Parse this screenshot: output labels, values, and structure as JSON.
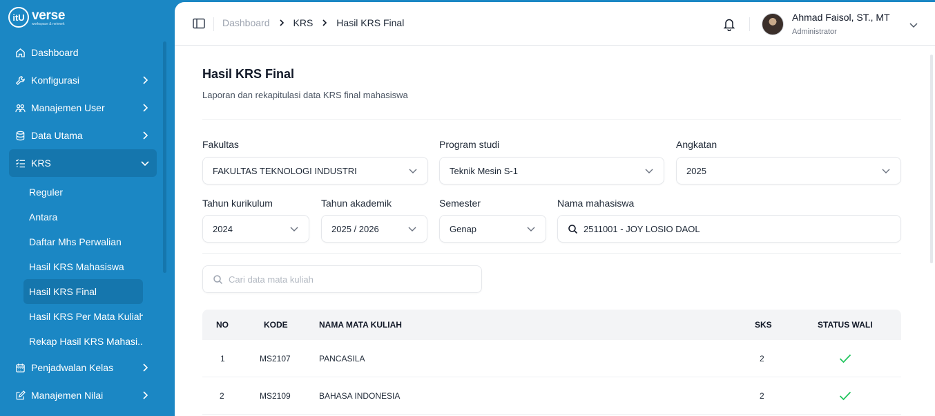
{
  "brand": {
    "mark": "itU",
    "word": "verse",
    "sub": "workspace & network"
  },
  "sidebar": {
    "items": [
      {
        "label": "Dashboard",
        "icon": "home-icon",
        "has_chevron": false
      },
      {
        "label": "Konfigurasi",
        "icon": "wrench-icon",
        "has_chevron": true
      },
      {
        "label": "Manajemen User",
        "icon": "users-icon",
        "has_chevron": true
      },
      {
        "label": "Data Utama",
        "icon": "database-icon",
        "has_chevron": true
      },
      {
        "label": "KRS",
        "icon": "list-check-icon",
        "has_chevron": true,
        "expanded": true
      }
    ],
    "krs_sub": [
      "Reguler",
      "Antara",
      "Daftar Mhs Perwalian",
      "Hasil KRS Mahasiswa",
      "Hasil KRS Final",
      "Hasil KRS Per Mata Kuliah",
      "Rekap Hasil KRS Mahasi..."
    ],
    "items_after": [
      {
        "label": "Penjadwalan Kelas",
        "icon": "calendar-icon"
      },
      {
        "label": "Manajemen Nilai",
        "icon": "edit-icon"
      }
    ],
    "active_sub": "Hasil KRS Final"
  },
  "topbar": {
    "breadcrumbs": [
      "Dashboard",
      "KRS",
      "Hasil KRS Final"
    ],
    "user_name": "Ahmad Faisol, ST., MT",
    "user_role": "Administrator"
  },
  "page": {
    "title": "Hasil KRS Final",
    "subtitle": "Laporan dan rekapitulasi data KRS final mahasiswa"
  },
  "filters": {
    "fakultas": {
      "label": "Fakultas",
      "value": "FAKULTAS TEKNOLOGI INDUSTRI"
    },
    "prodi": {
      "label": "Program studi",
      "value": "Teknik Mesin S-1"
    },
    "angkatan": {
      "label": "Angkatan",
      "value": "2025"
    },
    "kurikulum": {
      "label": "Tahun kurikulum",
      "value": "2024"
    },
    "akademik": {
      "label": "Tahun akademik",
      "value": "2025 / 2026"
    },
    "semester": {
      "label": "Semester",
      "value": "Genap"
    },
    "mahasiswa": {
      "label": "Nama mahasiswa",
      "value": "2511001 - JOY LOSIO DAOL"
    }
  },
  "search": {
    "placeholder": "Cari data mata kuliah",
    "value": ""
  },
  "table": {
    "headers": {
      "no": "NO",
      "kode": "KODE",
      "nama": "NAMA MATA KULIAH",
      "sks": "SKS",
      "status": "STATUS WALI"
    },
    "rows": [
      {
        "no": "1",
        "kode": "MS2107",
        "nama": "PANCASILA",
        "sks": "2",
        "status": "approved"
      },
      {
        "no": "2",
        "kode": "MS2109",
        "nama": "BAHASA INDONESIA",
        "sks": "2",
        "status": "approved"
      }
    ]
  },
  "colors": {
    "sidebar": "#1b87c4",
    "active": "#1576ad",
    "check": "#22c55e"
  }
}
